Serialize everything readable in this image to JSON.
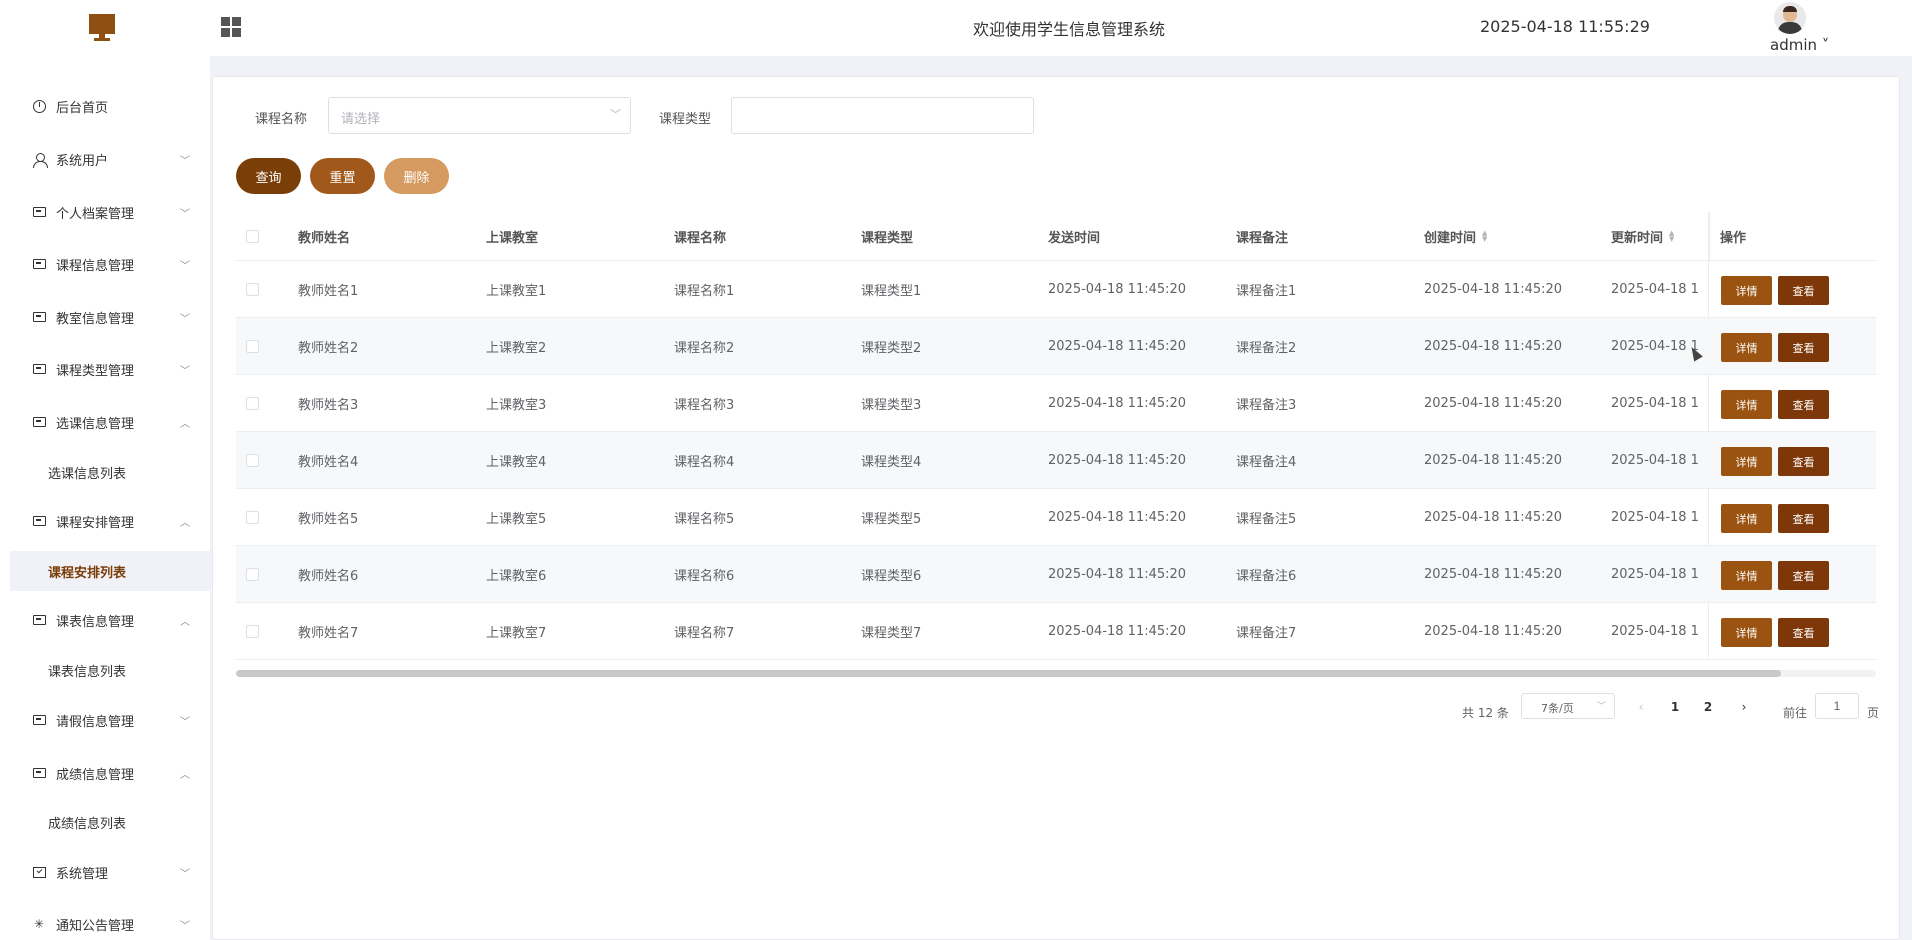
{
  "header": {
    "title": "欢迎使用学生信息管理系统",
    "datetime": "2025-04-18 11:55:29",
    "username": "admin ˅"
  },
  "sidebar": {
    "items": [
      {
        "label": "后台首页",
        "icon": "clock-icon"
      },
      {
        "label": "系统用户",
        "icon": "user-icon",
        "arrow": "﹀"
      },
      {
        "label": "个人档案管理",
        "icon": "folder-icon",
        "arrow": "﹀"
      },
      {
        "label": "课程信息管理",
        "icon": "folder-icon",
        "arrow": "﹀"
      },
      {
        "label": "教室信息管理",
        "icon": "folder-icon",
        "arrow": "﹀"
      },
      {
        "label": "课程类型管理",
        "icon": "folder-icon",
        "arrow": "﹀"
      },
      {
        "label": "选课信息管理",
        "icon": "folder-icon",
        "arrow": "︿"
      },
      {
        "label": "课程安排管理",
        "icon": "folder-icon",
        "arrow": "︿"
      },
      {
        "label": "课表信息管理",
        "icon": "folder-icon",
        "arrow": "︿"
      },
      {
        "label": "请假信息管理",
        "icon": "folder-icon",
        "arrow": "﹀"
      },
      {
        "label": "成绩信息管理",
        "icon": "folder-icon",
        "arrow": "︿"
      },
      {
        "label": "系统管理",
        "icon": "check-box-icon",
        "arrow": "﹀"
      },
      {
        "label": "通知公告管理",
        "icon": "loading-icon",
        "arrow": "﹀"
      }
    ],
    "sub_items": [
      {
        "label": "选课信息列表"
      },
      {
        "label": "课程安排列表"
      },
      {
        "label": "课表信息列表"
      },
      {
        "label": "成绩信息列表"
      }
    ]
  },
  "filters": {
    "course_name_label": "课程名称",
    "course_name_placeholder": "请选择",
    "course_type_label": "课程类型",
    "course_type_value": ""
  },
  "buttons": {
    "query": "查询",
    "reset": "重置",
    "delete": "删除"
  },
  "colors": {
    "query": "#7a3e08",
    "reset": "#a0581b",
    "delete": "#d49a5f"
  },
  "table": {
    "headers": [
      "教师姓名",
      "上课教室",
      "课程名称",
      "课程类型",
      "发送时间",
      "课程备注",
      "创建时间",
      "更新时间",
      "操作"
    ],
    "rows": [
      [
        "教师姓名1",
        "上课教室1",
        "课程名称1",
        "课程类型1",
        "2025-04-18 11:45:20",
        "课程备注1",
        "2025-04-18 11:45:20",
        "2025-04-18 1"
      ],
      [
        "教师姓名2",
        "上课教室2",
        "课程名称2",
        "课程类型2",
        "2025-04-18 11:45:20",
        "课程备注2",
        "2025-04-18 11:45:20",
        "2025-04-18 1"
      ],
      [
        "教师姓名3",
        "上课教室3",
        "课程名称3",
        "课程类型3",
        "2025-04-18 11:45:20",
        "课程备注3",
        "2025-04-18 11:45:20",
        "2025-04-18 1"
      ],
      [
        "教师姓名4",
        "上课教室4",
        "课程名称4",
        "课程类型4",
        "2025-04-18 11:45:20",
        "课程备注4",
        "2025-04-18 11:45:20",
        "2025-04-18 1"
      ],
      [
        "教师姓名5",
        "上课教室5",
        "课程名称5",
        "课程类型5",
        "2025-04-18 11:45:20",
        "课程备注5",
        "2025-04-18 11:45:20",
        "2025-04-18 1"
      ],
      [
        "教师姓名6",
        "上课教室6",
        "课程名称6",
        "课程类型6",
        "2025-04-18 11:45:20",
        "课程备注6",
        "2025-04-18 11:45:20",
        "2025-04-18 1"
      ],
      [
        "教师姓名7",
        "上课教室7",
        "课程名称7",
        "课程类型7",
        "2025-04-18 11:45:20",
        "课程备注7",
        "2025-04-18 11:45:20",
        "2025-04-18 1"
      ]
    ],
    "detail_label": "详情",
    "view_label": "查看"
  },
  "pagination": {
    "total": "共 12 条",
    "page_size": "7条/页",
    "pages": [
      "1",
      "2"
    ],
    "current_page": "1",
    "goto_label": "前往",
    "goto_value": "1",
    "page_suffix": "页"
  }
}
